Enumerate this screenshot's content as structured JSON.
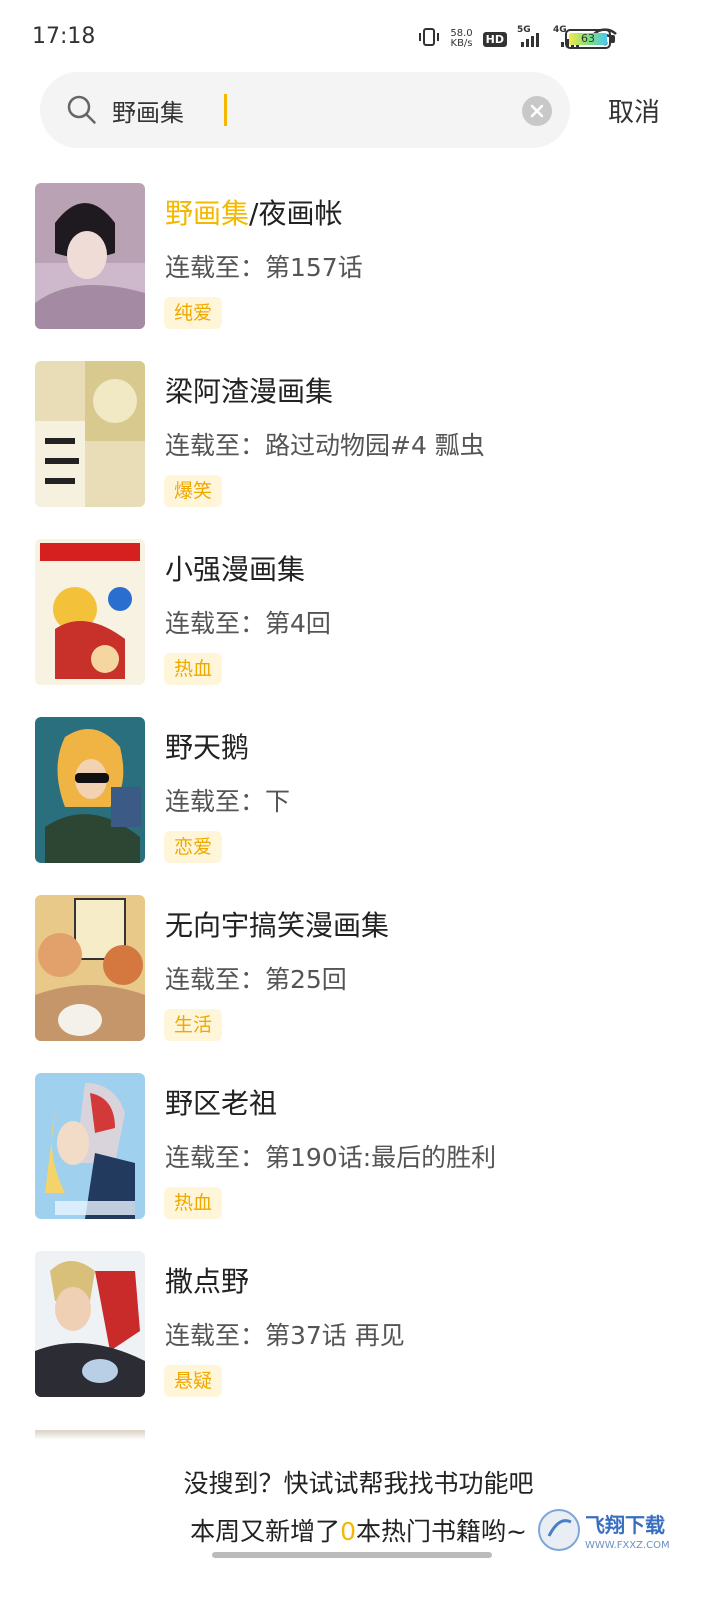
{
  "status_bar": {
    "time": "17:18",
    "net_speed_value": "58.0",
    "net_speed_unit": "KB/s",
    "hd_label": "HD",
    "sim1_label": "5G",
    "sim2_label": "4G",
    "battery_level": "63"
  },
  "search": {
    "query": "野画集",
    "cancel_label": "取消"
  },
  "results": [
    {
      "title_highlight": "野画集",
      "title_rest": "/夜画帐",
      "update": "连载至：第157话",
      "tag": "纯爱"
    },
    {
      "title_highlight": "",
      "title_rest": "梁阿渣漫画集",
      "update": "连载至：路过动物园#4 瓢虫",
      "tag": "爆笑"
    },
    {
      "title_highlight": "",
      "title_rest": "小强漫画集",
      "update": "连载至：第4回",
      "tag": "热血"
    },
    {
      "title_highlight": "",
      "title_rest": "野天鹅",
      "update": "连载至：下",
      "tag": "恋爱"
    },
    {
      "title_highlight": "",
      "title_rest": "无向宇搞笑漫画集",
      "update": "连载至：第25回",
      "tag": "生活"
    },
    {
      "title_highlight": "",
      "title_rest": "野区老祖",
      "update": "连载至：第190话:最后的胜利",
      "tag": "热血"
    },
    {
      "title_highlight": "",
      "title_rest": "撒点野",
      "update": "连载至：第37话 再见",
      "tag": "悬疑"
    }
  ],
  "footer": {
    "line1": "没搜到？快试试帮我找书功能吧",
    "line2_prefix": "本周又新增了",
    "line2_count": "0",
    "line2_suffix": "本热门书籍哟~",
    "watermark_text": "飞翔下载",
    "watermark_url": "WWW.FXXZ.COM"
  },
  "colors": {
    "accent": "#f5b800",
    "tag_bg": "#fff6da",
    "tag_text": "#f0a800",
    "search_bg": "#f4f4f4"
  }
}
